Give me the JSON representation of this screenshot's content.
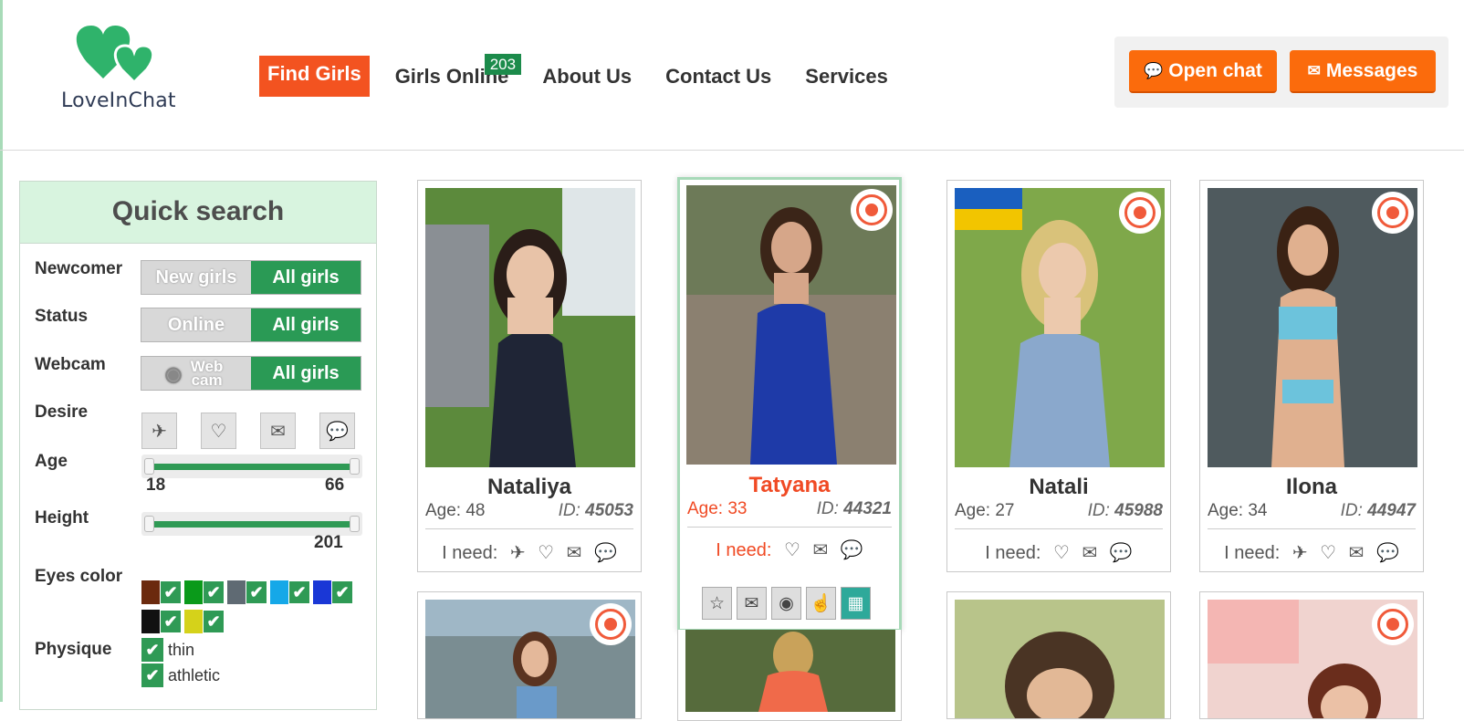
{
  "brand": {
    "name": "LoveInChat",
    "heart_color": "#2fb36b"
  },
  "nav": {
    "items": [
      "Find Girls",
      "Girls Online",
      "About Us",
      "Contact Us",
      "Services"
    ],
    "online_count": "203"
  },
  "header_actions": {
    "open_chat": "Open chat",
    "messages": "Messages",
    "chat_icon": "chat-bubble-icon",
    "msg_icon": "envelope-icon"
  },
  "sidebar": {
    "title": "Quick search",
    "newcomer": {
      "label": "Newcomer",
      "off": "New girls",
      "on": "All girls"
    },
    "status": {
      "label": "Status",
      "off": "Online",
      "on": "All girls"
    },
    "webcam": {
      "label": "Webcam",
      "off": "Web cam",
      "on": "All girls"
    },
    "desire": {
      "label": "Desire",
      "icons": [
        "airplane-icon",
        "rings-icon",
        "chat-icon",
        "conversation-icon"
      ]
    },
    "age": {
      "label": "Age",
      "min": "18",
      "max": "66"
    },
    "height": {
      "label": "Height",
      "max": "201"
    },
    "eyes": {
      "label": "Eyes color",
      "colors": [
        "#6b2a0e",
        "#0a9a1a",
        "#5f6a73",
        "#15a8e8",
        "#1a37d6",
        "#111111",
        "#d5d21a"
      ]
    },
    "physique": {
      "label": "Physique",
      "options": [
        "thin",
        "athletic"
      ]
    }
  },
  "cards": [
    {
      "name": "Nataliya",
      "age": "Age: 48",
      "id_label": "ID:",
      "id": "45053",
      "need_label": "I need:",
      "icons": [
        "airplane",
        "rings",
        "chat",
        "talk"
      ]
    },
    {
      "name": "Tatyana",
      "age": "Age: 33",
      "id_label": "ID:",
      "id": "44321",
      "need_label": "I need:",
      "icons": [
        "rings",
        "chat",
        "talk"
      ]
    },
    {
      "name": "Natali",
      "age": "Age: 27",
      "id_label": "ID:",
      "id": "45988",
      "need_label": "I need:",
      "icons": [
        "rings",
        "chat",
        "talk"
      ]
    },
    {
      "name": "Ilona",
      "age": "Age: 34",
      "id_label": "ID:",
      "id": "44947",
      "need_label": "I need:",
      "icons": [
        "airplane",
        "rings",
        "chat",
        "talk"
      ]
    }
  ]
}
